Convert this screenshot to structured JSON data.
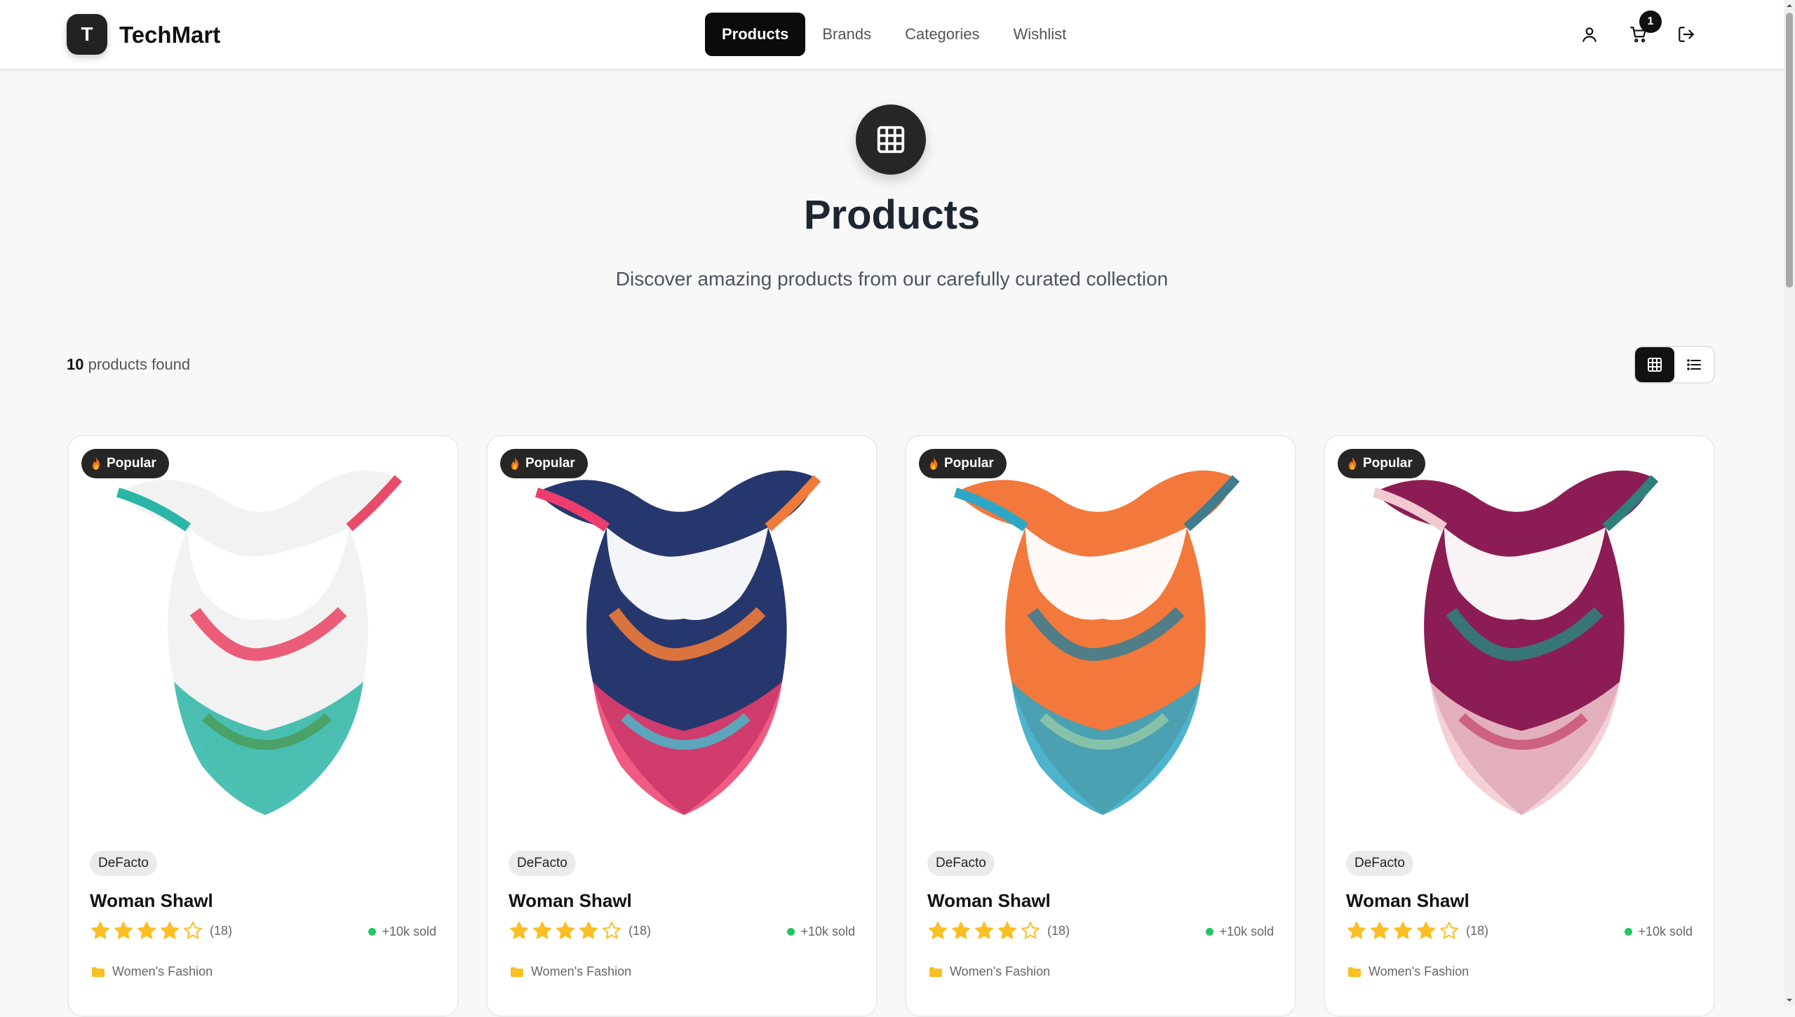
{
  "brand": {
    "initial": "T",
    "name": "TechMart"
  },
  "nav": [
    {
      "label": "Products",
      "active": true
    },
    {
      "label": "Brands",
      "active": false
    },
    {
      "label": "Categories",
      "active": false
    },
    {
      "label": "Wishlist",
      "active": false
    }
  ],
  "header_icons": [
    "user-icon",
    "cart-icon",
    "logout-icon"
  ],
  "cart_count": "1",
  "hero": {
    "icon": "grid-icon",
    "title": "Products",
    "subtitle": "Discover amazing products from our carefully curated collection"
  },
  "results": {
    "count": "10",
    "suffix": "products found"
  },
  "view_toggle": {
    "options": [
      "grid-view-icon",
      "list-view-icon"
    ],
    "selected": "grid"
  },
  "products": [
    {
      "badge": "Popular",
      "brand": "DeFacto",
      "name": "Woman Shawl",
      "rating": 4,
      "rating_count": "(18)",
      "sold": "+10k sold",
      "category": "Women's Fashion",
      "palette": [
        "#f2f2f2",
        "#2bb5a6",
        "#e94b6a",
        "#4a9d5c"
      ]
    },
    {
      "badge": "Popular",
      "brand": "DeFacto",
      "name": "Woman Shawl",
      "rating": 4,
      "rating_count": "(18)",
      "sold": "+10k sold",
      "category": "Women's Fashion",
      "palette": [
        "#26376e",
        "#ee3d6c",
        "#f07a3a",
        "#49b7c9"
      ]
    },
    {
      "badge": "Popular",
      "brand": "DeFacto",
      "name": "Woman Shawl",
      "rating": 4,
      "rating_count": "(18)",
      "sold": "+10k sold",
      "category": "Women's Fashion",
      "palette": [
        "#f2783c",
        "#2ea7c6",
        "#3f7d8e",
        "#8fc8a8"
      ]
    },
    {
      "badge": "Popular",
      "brand": "DeFacto",
      "name": "Woman Shawl",
      "rating": 4,
      "rating_count": "(18)",
      "sold": "+10k sold",
      "category": "Women's Fashion",
      "palette": [
        "#8c1d54",
        "#f2c9d0",
        "#2f7f7a",
        "#c95478"
      ]
    }
  ],
  "colors": {
    "accent": "#111111",
    "star": "#fbbf24",
    "sold_dot": "#22c55e",
    "folder": "#fbbf24"
  }
}
